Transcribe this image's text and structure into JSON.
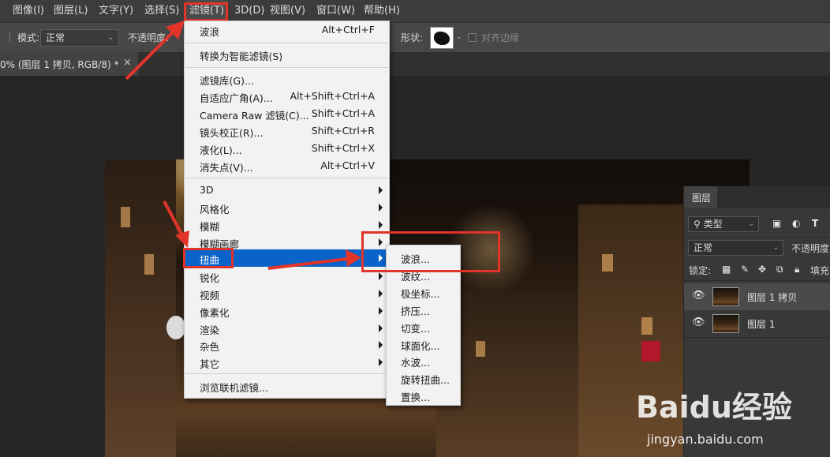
{
  "menubar": {
    "items": [
      "图像(I)",
      "图层(L)",
      "文字(Y)",
      "选择(S)",
      "滤镜(T)",
      "3D(D)",
      "视图(V)",
      "窗口(W)",
      "帮助(H)"
    ]
  },
  "options": {
    "mode_label": "模式:",
    "mode_value": "正常",
    "opacity_label": "不透明度:",
    "shape_label": "形状:",
    "align_label": "对齐边缘"
  },
  "document": {
    "tab_label": "0% (图层 1 拷贝, RGB/8) *",
    "close": "×"
  },
  "filter_menu": {
    "items": [
      {
        "label": "波浪",
        "shortcut": "Alt+Ctrl+F"
      },
      {
        "label": "转换为智能滤镜(S)",
        "shortcut": ""
      },
      {
        "label": "滤镜库(G)...",
        "shortcut": ""
      },
      {
        "label": "自适应广角(A)...",
        "shortcut": "Alt+Shift+Ctrl+A"
      },
      {
        "label": "Camera Raw 滤镜(C)...",
        "shortcut": "Shift+Ctrl+A"
      },
      {
        "label": "镜头校正(R)...",
        "shortcut": "Shift+Ctrl+R"
      },
      {
        "label": "液化(L)...",
        "shortcut": "Shift+Ctrl+X"
      },
      {
        "label": "消失点(V)...",
        "shortcut": "Alt+Ctrl+V"
      },
      {
        "label": "3D",
        "shortcut": ""
      },
      {
        "label": "风格化",
        "shortcut": ""
      },
      {
        "label": "模糊",
        "shortcut": ""
      },
      {
        "label": "模糊画廊",
        "shortcut": ""
      },
      {
        "label": "扭曲",
        "shortcut": ""
      },
      {
        "label": "锐化",
        "shortcut": ""
      },
      {
        "label": "视频",
        "shortcut": ""
      },
      {
        "label": "像素化",
        "shortcut": ""
      },
      {
        "label": "渲染",
        "shortcut": ""
      },
      {
        "label": "杂色",
        "shortcut": ""
      },
      {
        "label": "其它",
        "shortcut": ""
      },
      {
        "label": "浏览联机滤镜...",
        "shortcut": ""
      }
    ]
  },
  "distort_submenu": {
    "items": [
      "波浪...",
      "波纹...",
      "极坐标...",
      "挤压...",
      "切变...",
      "球面化...",
      "水波...",
      "旋转扭曲...",
      "置换..."
    ]
  },
  "layers_panel": {
    "tab": "图层",
    "filter_kind": "类型",
    "blend_mode": "正常",
    "opacity_label": "不透明度",
    "lock_label": "锁定:",
    "fill_label": "填充",
    "layers": [
      "图层 1 拷贝",
      "图层 1"
    ]
  },
  "watermark": {
    "logo": "Baidu经验",
    "url": "jingyan.baidu.com"
  },
  "colors": {
    "highlight": "#0a63c9",
    "annotation": "#e3342a"
  }
}
